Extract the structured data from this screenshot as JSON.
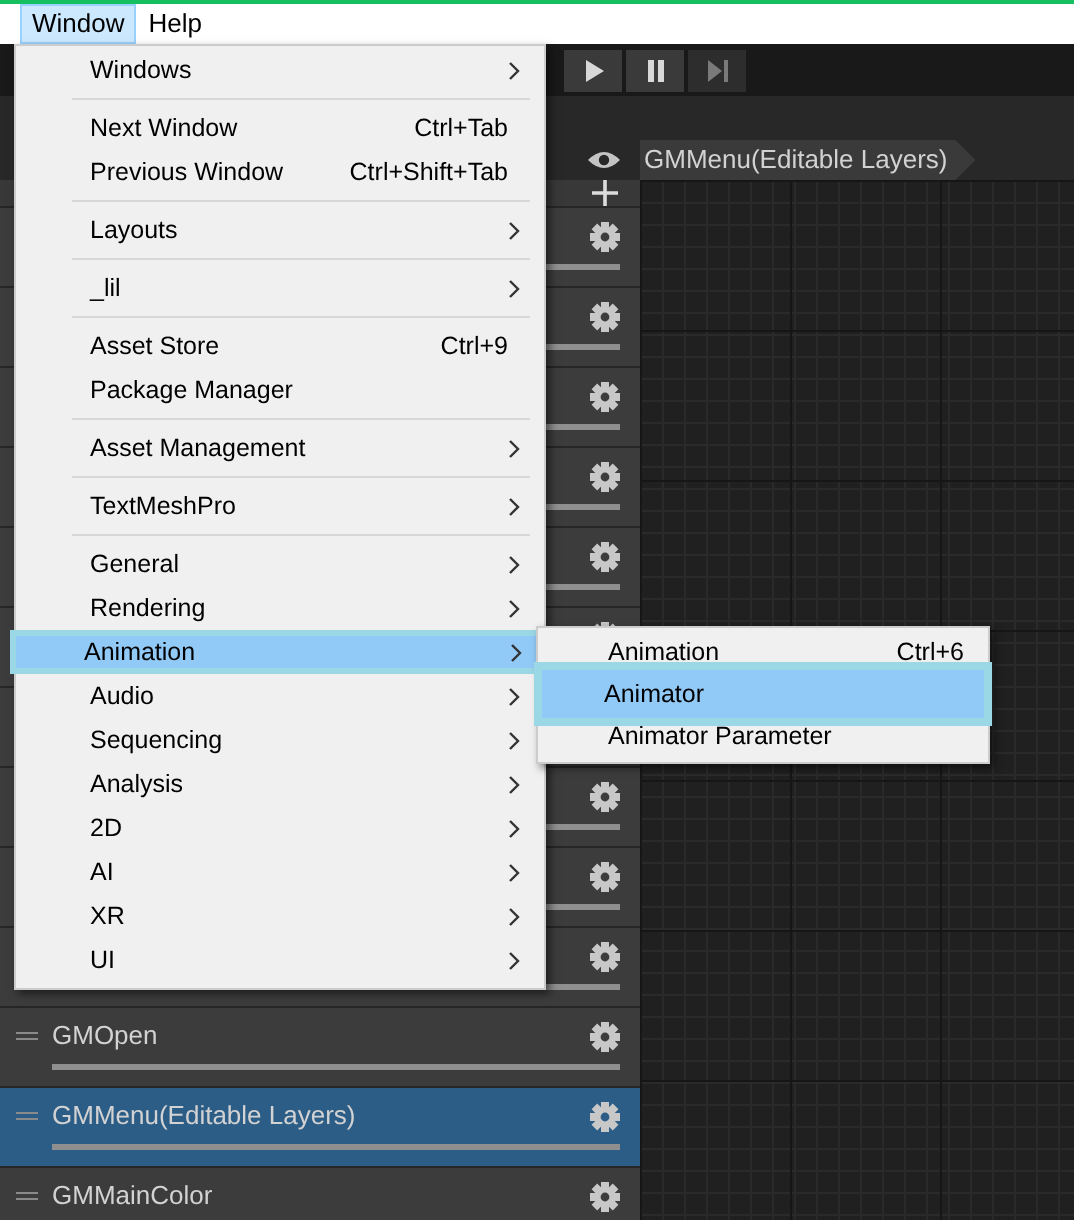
{
  "menubar": [
    {
      "label": "Window",
      "selected": true
    },
    {
      "label": "Help",
      "selected": false
    }
  ],
  "toolbar": {
    "buttons": [
      {
        "kind": "play",
        "disabled": false
      },
      {
        "kind": "pause",
        "disabled": false
      },
      {
        "kind": "step",
        "disabled": true
      }
    ]
  },
  "graph_header": {
    "breadcrumb": "GMMenu(Editable Layers)"
  },
  "layers": [
    {
      "selected": false
    },
    {
      "selected": false
    },
    {
      "selected": false
    },
    {
      "selected": false
    },
    {
      "selected": false
    },
    {
      "selected": false
    },
    {
      "selected": false,
      "gear": false
    },
    {
      "selected": false
    },
    {
      "selected": false
    },
    {
      "selected": false
    },
    {
      "name": "GMOpen",
      "selected": false
    },
    {
      "name": "GMMenu(Editable Layers)",
      "selected": true
    },
    {
      "name": "GMMainColor",
      "selected": false
    }
  ],
  "menu": {
    "items": [
      {
        "kind": "item",
        "label": "Windows",
        "submenu": true,
        "selected": false
      },
      {
        "kind": "separator"
      },
      {
        "kind": "item",
        "label": "Next Window",
        "shortcut": "Ctrl+Tab",
        "submenu": false,
        "selected": false
      },
      {
        "kind": "item",
        "label": "Previous Window",
        "shortcut": "Ctrl+Shift+Tab",
        "submenu": false,
        "selected": false
      },
      {
        "kind": "separator"
      },
      {
        "kind": "item",
        "label": "Layouts",
        "submenu": true,
        "selected": false
      },
      {
        "kind": "separator"
      },
      {
        "kind": "item",
        "label": "_lil",
        "submenu": true,
        "selected": false
      },
      {
        "kind": "separator"
      },
      {
        "kind": "item",
        "label": "Asset Store",
        "shortcut": "Ctrl+9",
        "submenu": false,
        "selected": false
      },
      {
        "kind": "item",
        "label": "Package Manager",
        "submenu": false,
        "selected": false
      },
      {
        "kind": "separator"
      },
      {
        "kind": "item",
        "label": "Asset Management",
        "submenu": true,
        "selected": false
      },
      {
        "kind": "separator"
      },
      {
        "kind": "item",
        "label": "TextMeshPro",
        "submenu": true,
        "selected": false
      },
      {
        "kind": "separator"
      },
      {
        "kind": "item",
        "label": "General",
        "submenu": true,
        "selected": false
      },
      {
        "kind": "item",
        "label": "Rendering",
        "submenu": true,
        "selected": false
      },
      {
        "kind": "item",
        "label": "Animation",
        "submenu": true,
        "selected": true
      },
      {
        "kind": "item",
        "label": "Audio",
        "submenu": true,
        "selected": false
      },
      {
        "kind": "item",
        "label": "Sequencing",
        "submenu": true,
        "selected": false
      },
      {
        "kind": "item",
        "label": "Analysis",
        "submenu": true,
        "selected": false
      },
      {
        "kind": "item",
        "label": "2D",
        "submenu": true,
        "selected": false
      },
      {
        "kind": "item",
        "label": "AI",
        "submenu": true,
        "selected": false
      },
      {
        "kind": "item",
        "label": "XR",
        "submenu": true,
        "selected": false
      },
      {
        "kind": "item",
        "label": "UI",
        "submenu": true,
        "selected": false
      }
    ]
  },
  "submenu": {
    "items": [
      {
        "label": "Animation",
        "shortcut": "Ctrl+6",
        "selected": false
      },
      {
        "label": "Animator",
        "selected": true
      },
      {
        "label": "Animator Parameter",
        "selected": false
      }
    ]
  }
}
